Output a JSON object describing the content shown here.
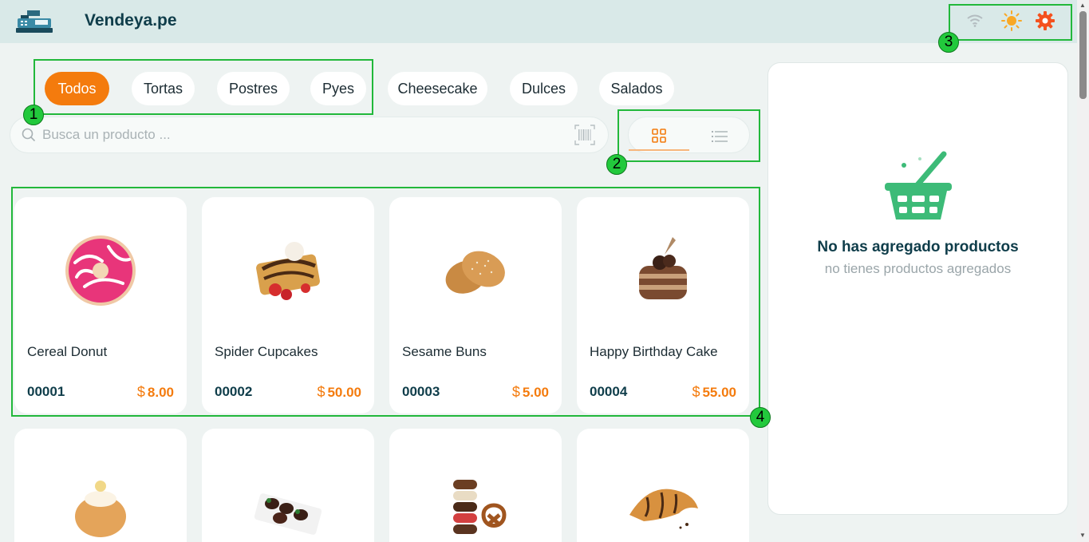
{
  "app": {
    "brand": "Vendeya.pe"
  },
  "header_icons": {
    "wifi": "wifi-icon",
    "theme": "sun-icon",
    "settings": "gear-icon"
  },
  "categories": [
    {
      "label": "Todos",
      "active": true
    },
    {
      "label": "Tortas",
      "active": false
    },
    {
      "label": "Postres",
      "active": false
    },
    {
      "label": "Pyes",
      "active": false
    },
    {
      "label": "Cheesecake",
      "active": false
    },
    {
      "label": "Dulces",
      "active": false
    },
    {
      "label": "Salados",
      "active": false
    }
  ],
  "search": {
    "placeholder": "Busca un producto ...",
    "value": ""
  },
  "view_toggle": {
    "selected": "grid",
    "options": [
      "grid",
      "list"
    ]
  },
  "products": [
    {
      "name": "Cereal Donut",
      "code": "00001",
      "currency": "$",
      "price": "8.00",
      "image": "donut"
    },
    {
      "name": "Spider Cupcakes",
      "code": "00002",
      "currency": "$",
      "price": "50.00",
      "image": "waffle"
    },
    {
      "name": "Sesame Buns",
      "code": "00003",
      "currency": "$",
      "price": "5.00",
      "image": "buns"
    },
    {
      "name": "Happy Birthday Cake",
      "code": "00004",
      "currency": "$",
      "price": "55.00",
      "image": "cake"
    },
    {
      "name": "",
      "code": "",
      "currency": "",
      "price": "",
      "image": "cream-puff"
    },
    {
      "name": "",
      "code": "",
      "currency": "",
      "price": "",
      "image": "strawberries"
    },
    {
      "name": "",
      "code": "",
      "currency": "",
      "price": "",
      "image": "cookies-pretzel"
    },
    {
      "name": "",
      "code": "",
      "currency": "",
      "price": "",
      "image": "croissant"
    }
  ],
  "cart": {
    "title": "No has agregado productos",
    "subtitle": "no tienes productos agregados"
  },
  "annotations": [
    "1",
    "2",
    "3",
    "4"
  ],
  "colors": {
    "accent": "#f47b0d",
    "header_bg": "#d9e9e8",
    "annotation": "#22b83b",
    "basket": "#3dbb78"
  }
}
